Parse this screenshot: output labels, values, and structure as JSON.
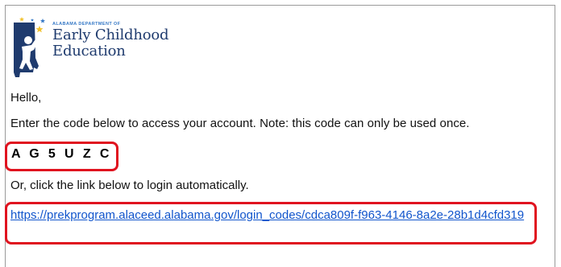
{
  "logo": {
    "kicker": "ALABAMA DEPARTMENT OF",
    "line1": "Early Childhood",
    "line2": "Education",
    "icon": "alabama-state-child-stars-icon",
    "colors": {
      "navy": "#1f3b6e",
      "accent_blue": "#3578c6",
      "star_yellow": "#f2c230"
    }
  },
  "email": {
    "greeting": "Hello,",
    "intro": "Enter the code below to access your account. Note: this code can only be used once.",
    "code": "A G 5 U Z C",
    "alt_instruction": "Or, click the link below to login automatically.",
    "login_link": "https://prekprogram.alaceed.alabama.gov/login_codes/cdca809f-f963-4146-8a2e-28b1d4cfd319"
  },
  "highlight_color": "#e0131f",
  "link_color": "#1155cc"
}
